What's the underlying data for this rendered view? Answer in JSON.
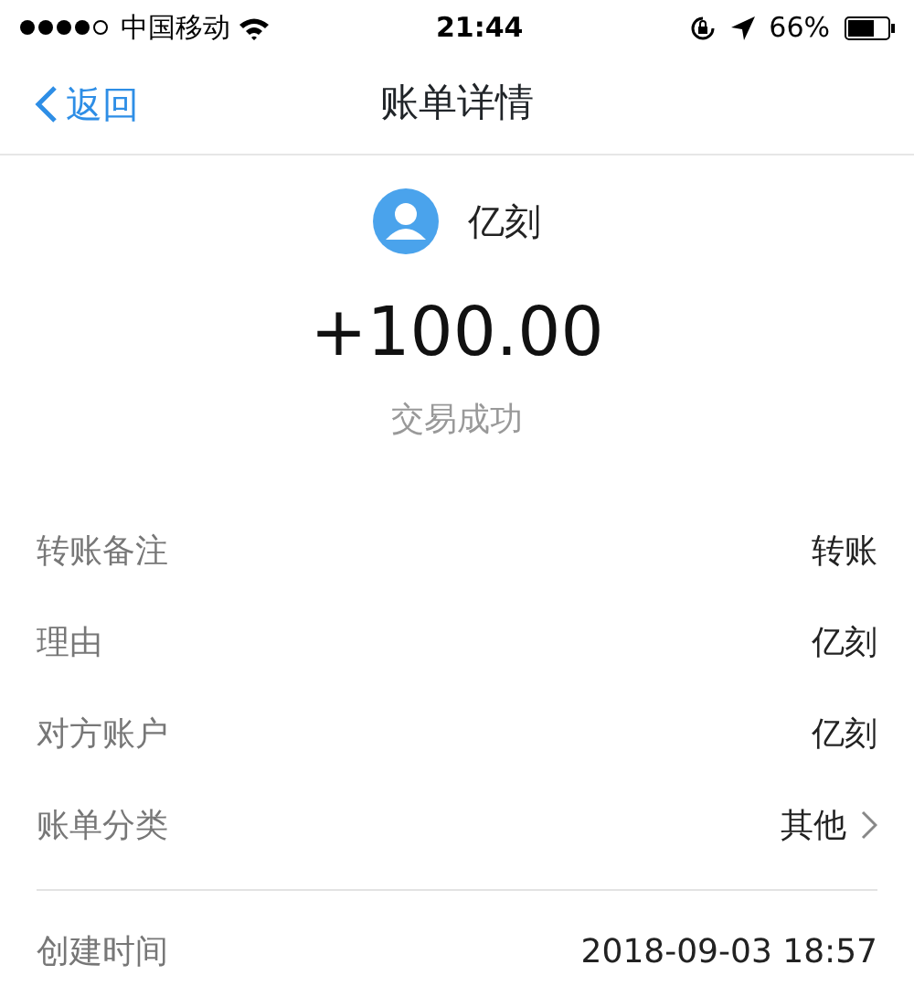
{
  "status_bar": {
    "carrier": "中国移动",
    "time": "21:44",
    "battery": "66%"
  },
  "nav": {
    "back": "返回",
    "title": "账单详情"
  },
  "payee": {
    "name": "亿刻"
  },
  "amount": "+100.00",
  "result": "交易成功",
  "details": [
    {
      "label": "转账备注",
      "value": "转账",
      "kind": "plain"
    },
    {
      "label": "理由",
      "value": "亿刻",
      "kind": "plain"
    },
    {
      "label": "对方账户",
      "value": "亿刻",
      "kind": "plain"
    },
    {
      "label": "账单分类",
      "value": "其他",
      "kind": "link"
    }
  ],
  "times": [
    {
      "label": "创建时间",
      "value": "2018-09-03 18:57"
    }
  ]
}
